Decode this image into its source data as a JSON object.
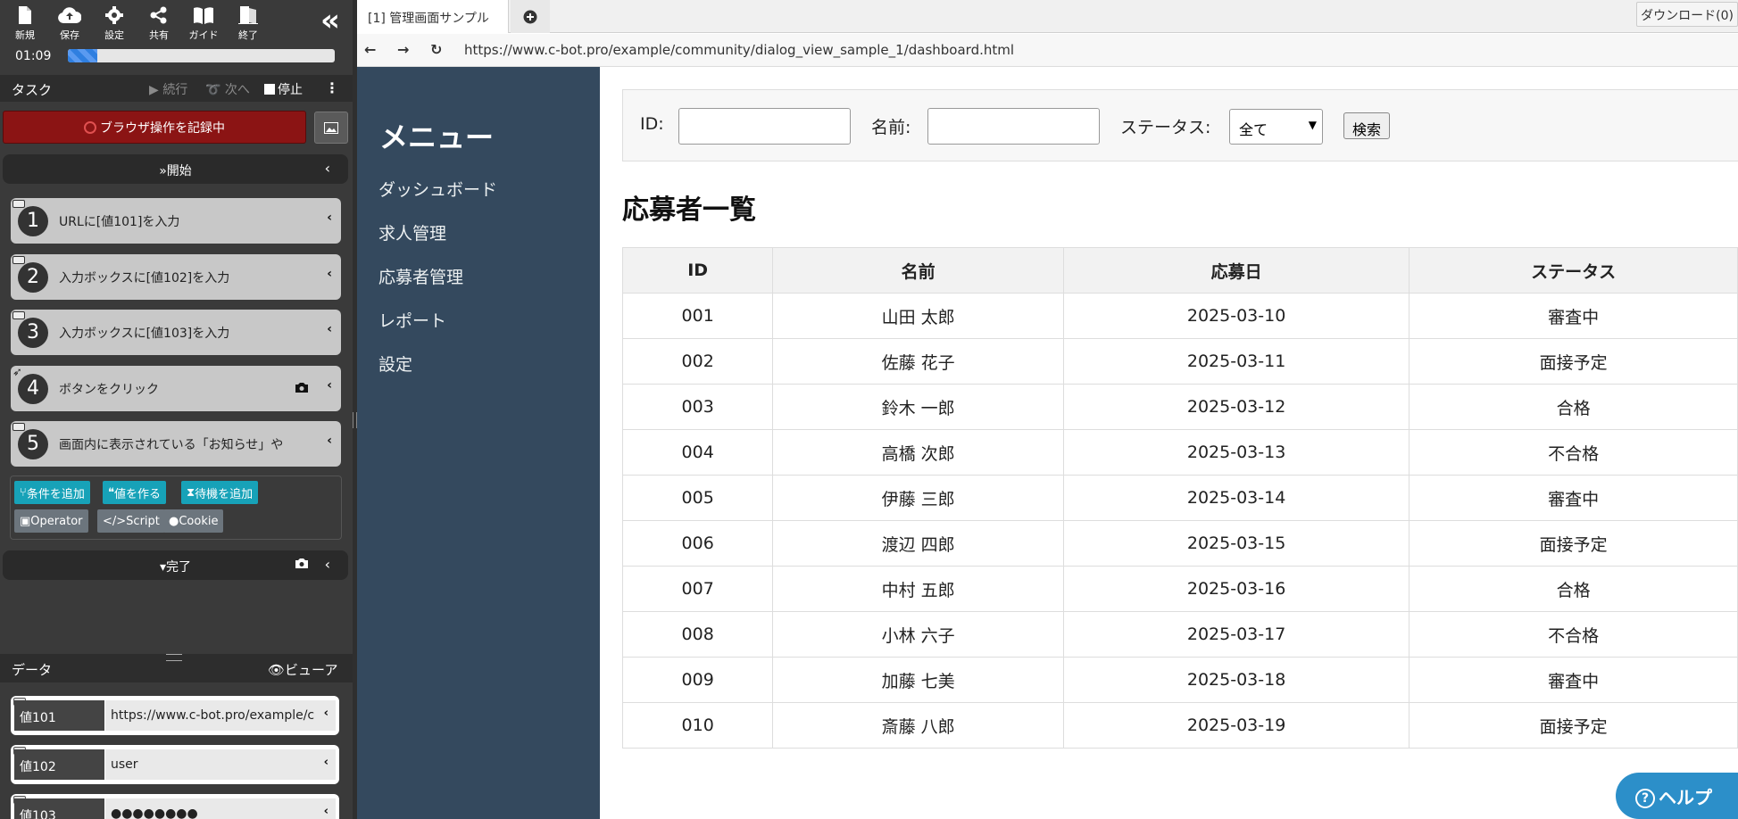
{
  "toolbar": {
    "new": "新規",
    "save": "保存",
    "settings": "設定",
    "share": "共有",
    "guide": "ガイド",
    "exit": "終了"
  },
  "timer": "01:09",
  "progress_fraction": 0.11,
  "task": {
    "title": "タスク",
    "continue": "続行",
    "next": "次へ",
    "stop": "停止"
  },
  "recording_label": "ブラウザ操作を記録中",
  "start_label": "開始",
  "steps": [
    {
      "num": "1",
      "text": "URLに[値101]を入力"
    },
    {
      "num": "2",
      "text": "入力ボックスに[値102]を入力"
    },
    {
      "num": "3",
      "text": "入力ボックスに[値103]を入力"
    },
    {
      "num": "4",
      "text": "ボタンをクリック"
    },
    {
      "num": "5",
      "text": "画面内に表示されている「お知らせ」や"
    }
  ],
  "actions": {
    "add_condition": "条件を追加",
    "make_value": "値を作る",
    "add_wait": "待機を追加",
    "operator": "Operator",
    "script": "Script",
    "cookie": "Cookie"
  },
  "end_label": "完了",
  "data_panel": {
    "title": "データ",
    "viewer": "ビューア",
    "rows": [
      {
        "name": "値101",
        "value": "https://www.c-bot.pro/example/c"
      },
      {
        "name": "値102",
        "value": "user"
      },
      {
        "name": "値103",
        "value": "●●●●●●●●"
      }
    ]
  },
  "browser": {
    "tab_title": "[1] 管理画面サンプル",
    "download": "ダウンロード(0)",
    "url": "https://www.c-bot.pro/example/community/dialog_view_sample_1/dashboard.html"
  },
  "page": {
    "menu_title": "メニュー",
    "menu": [
      "ダッシュボード",
      "求人管理",
      "応募者管理",
      "レポート",
      "設定"
    ],
    "filter": {
      "id_label": "ID:",
      "name_label": "名前:",
      "status_label": "ステータス:",
      "status_value": "全て",
      "search": "検索"
    },
    "heading": "応募者一覧",
    "columns": [
      "ID",
      "名前",
      "応募日",
      "ステータス"
    ],
    "rows": [
      [
        "001",
        "山田 太郎",
        "2025-03-10",
        "審査中"
      ],
      [
        "002",
        "佐藤 花子",
        "2025-03-11",
        "面接予定"
      ],
      [
        "003",
        "鈴木 一郎",
        "2025-03-12",
        "合格"
      ],
      [
        "004",
        "高橋 次郎",
        "2025-03-13",
        "不合格"
      ],
      [
        "005",
        "伊藤 三郎",
        "2025-03-14",
        "審査中"
      ],
      [
        "006",
        "渡辺 四郎",
        "2025-03-15",
        "面接予定"
      ],
      [
        "007",
        "中村 五郎",
        "2025-03-16",
        "合格"
      ],
      [
        "008",
        "小林 六子",
        "2025-03-17",
        "不合格"
      ],
      [
        "009",
        "加藤 七美",
        "2025-03-18",
        "審査中"
      ],
      [
        "010",
        "斎藤 八郎",
        "2025-03-19",
        "面接予定"
      ]
    ],
    "help": "ヘルプ"
  }
}
